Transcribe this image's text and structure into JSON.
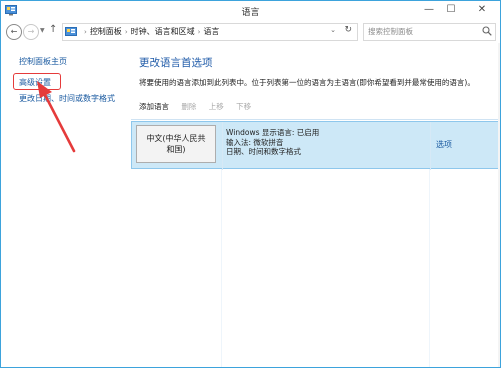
{
  "window": {
    "title": "语言",
    "minimize": "—",
    "maximize": "☐",
    "close": "✕"
  },
  "address": {
    "back": "←",
    "forward": "→",
    "up": "↑",
    "crumbs": [
      "控制面板",
      "时钟、语言和区域",
      "语言"
    ],
    "search_placeholder": "搜索控制面板"
  },
  "sidebar": {
    "items": [
      {
        "label": "控制面板主页"
      },
      {
        "label": "高级设置"
      },
      {
        "label": "更改日期、时间或数字格式"
      }
    ]
  },
  "main": {
    "heading": "更改语言首选项",
    "description": "将要使用的语言添加到此列表中。位于列表第一位的语言为主语言(即你希望看到并最常使用的语言)。",
    "toolbar": {
      "add": "添加语言",
      "remove": "删除",
      "move_up": "上移",
      "move_down": "下移"
    },
    "languages": [
      {
        "name": "中文(中华人民共和国)",
        "info_lines": [
          "Windows 显示语言: 已启用",
          "输入法: 微软拼音",
          "日期、时间和数字格式"
        ],
        "options": "选项"
      }
    ]
  },
  "colors": {
    "accent": "#1e5aa8",
    "selection": "#cde8f7",
    "annotation": "#e53b3b"
  }
}
